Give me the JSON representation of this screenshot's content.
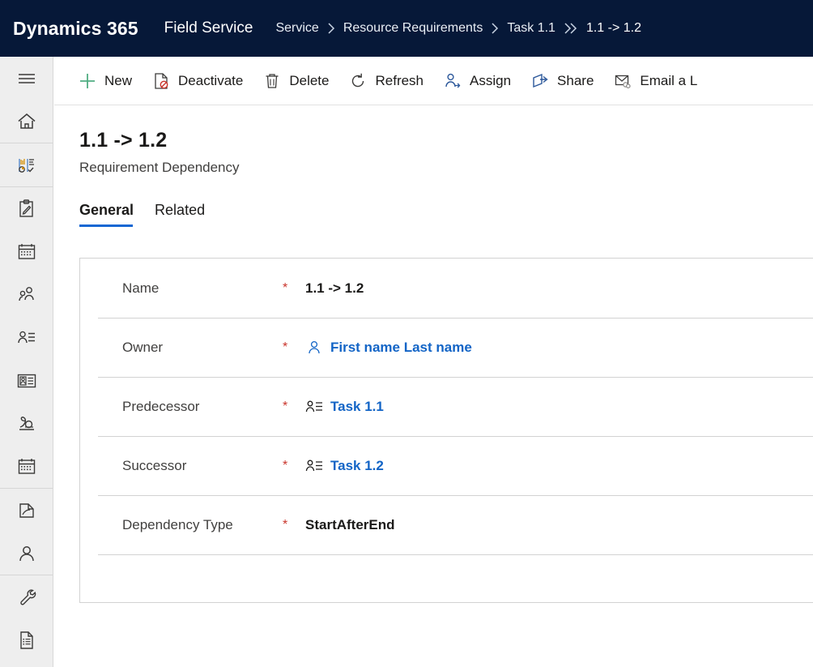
{
  "app_bar": {
    "brand": "Dynamics 365",
    "app_name": "Field Service",
    "breadcrumb": [
      {
        "label": "Service",
        "separator": "chevron-right-icon"
      },
      {
        "label": "Resource Requirements",
        "separator": "chevron-right-icon"
      },
      {
        "label": "Task 1.1",
        "separator": "double-chevron-right-icon"
      },
      {
        "label": "1.1 -> 1.2",
        "separator": ""
      }
    ],
    "background_color": "#061838",
    "text_color": "#ffffff"
  },
  "sidebar": {
    "items": [
      {
        "name": "hamburger-menu-icon",
        "group": 0
      },
      {
        "name": "home-icon",
        "group": 0
      },
      {
        "name": "dashboard-chart-icon",
        "group": 1
      },
      {
        "name": "clipboard-task-icon",
        "group": 2
      },
      {
        "name": "calendar-icon",
        "group": 2
      },
      {
        "name": "people-group-icon",
        "group": 2
      },
      {
        "name": "contact-record-icon",
        "group": 2
      },
      {
        "name": "id-badge-icon",
        "group": 2
      },
      {
        "name": "agreement-icon",
        "group": 2
      },
      {
        "name": "schedule-board-calendar-icon",
        "group": 2
      },
      {
        "name": "work-order-folder-icon",
        "group": 3
      },
      {
        "name": "account-person-icon",
        "group": 3
      },
      {
        "name": "wrench-tool-icon",
        "group": 4
      },
      {
        "name": "document-list-icon",
        "group": 4
      }
    ]
  },
  "command_bar": {
    "buttons": [
      {
        "label": "New",
        "icon": "plus-icon",
        "icon_color": "#50ad82"
      },
      {
        "label": "Deactivate",
        "icon": "deactivate-document-icon",
        "icon_color": "#3b3a39"
      },
      {
        "label": "Delete",
        "icon": "trash-icon",
        "icon_color": "#3b3a39"
      },
      {
        "label": "Refresh",
        "icon": "refresh-icon",
        "icon_color": "#3b3a39"
      },
      {
        "label": "Assign",
        "icon": "assign-person-icon",
        "icon_color": "#2b579a"
      },
      {
        "label": "Share",
        "icon": "share-arrow-icon",
        "icon_color": "#2b579a"
      },
      {
        "label": "Email a L",
        "icon": "email-link-icon",
        "icon_color": "#3b3a39"
      }
    ]
  },
  "record": {
    "title": "1.1 -> 1.2",
    "subtitle": "Requirement Dependency",
    "tabs": [
      {
        "label": "General",
        "active": true
      },
      {
        "label": "Related",
        "active": false
      }
    ],
    "accent_color": "#1567d3",
    "required_marker": "*",
    "fields": [
      {
        "label": "Name",
        "required": true,
        "value": "1.1 -> 1.2",
        "icon": "",
        "is_link": false
      },
      {
        "label": "Owner",
        "required": true,
        "value": "First name Last name",
        "icon": "person-outline-icon",
        "is_link": true
      },
      {
        "label": "Predecessor",
        "required": true,
        "value": "Task 1.1",
        "icon": "contact-record-icon",
        "is_link": true
      },
      {
        "label": "Successor",
        "required": true,
        "value": "Task 1.2",
        "icon": "contact-record-icon",
        "is_link": true
      },
      {
        "label": "Dependency Type",
        "required": true,
        "value": "StartAfterEnd",
        "icon": "",
        "is_link": false
      }
    ]
  }
}
